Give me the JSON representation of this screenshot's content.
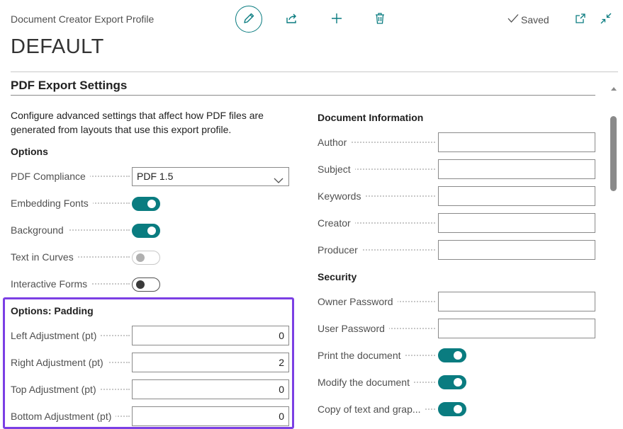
{
  "header": {
    "app_title": "Document Creator Export Profile",
    "record_title": "DEFAULT",
    "saved_label": "Saved",
    "icons": [
      "pencil-icon",
      "share-icon",
      "plus-icon",
      "trash-icon",
      "check-icon",
      "popout-icon",
      "collapse-icon"
    ]
  },
  "section": {
    "title": "PDF Export Settings",
    "description": "Configure advanced settings that affect how PDF files are generated from layouts that use this export profile."
  },
  "options": {
    "heading": "Options",
    "pdf_compliance": {
      "label": "PDF Compliance",
      "value": "PDF 1.5"
    },
    "embedding_fonts": {
      "label": "Embedding Fonts",
      "state": "on"
    },
    "background": {
      "label": "Background",
      "state": "on"
    },
    "text_in_curves": {
      "label": "Text in Curves",
      "state": "disabled-off"
    },
    "interactive_forms": {
      "label": "Interactive Forms",
      "state": "off"
    }
  },
  "padding": {
    "heading": "Options: Padding",
    "left": {
      "label": "Left Adjustment (pt)",
      "value": "0"
    },
    "right": {
      "label": "Right Adjustment (pt)",
      "value": "2"
    },
    "top": {
      "label": "Top Adjustment (pt)",
      "value": "0"
    },
    "bottom": {
      "label": "Bottom Adjustment (pt)",
      "value": "0"
    },
    "highlight_color": "#7b3fe4"
  },
  "doc_info": {
    "heading": "Document Information",
    "author": {
      "label": "Author",
      "value": ""
    },
    "subject": {
      "label": "Subject",
      "value": ""
    },
    "keywords": {
      "label": "Keywords",
      "value": ""
    },
    "creator": {
      "label": "Creator",
      "value": ""
    },
    "producer": {
      "label": "Producer",
      "value": ""
    }
  },
  "security": {
    "heading": "Security",
    "owner_password": {
      "label": "Owner Password",
      "value": ""
    },
    "user_password": {
      "label": "User Password",
      "value": ""
    },
    "print_document": {
      "label": "Print the document",
      "state": "on"
    },
    "modify_document": {
      "label": "Modify the document",
      "state": "on"
    },
    "copy_text": {
      "label": "Copy of text and grap...",
      "state": "on"
    }
  },
  "colors": {
    "accent": "#0a7c80",
    "text": "#212121",
    "muted": "#505050"
  }
}
